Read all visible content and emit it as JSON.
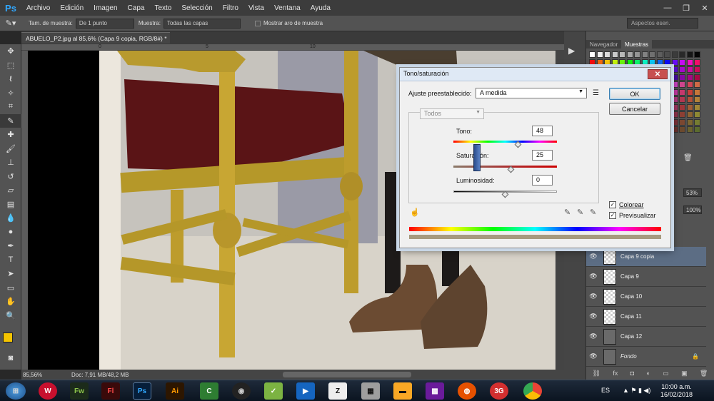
{
  "menubar": {
    "logo": "Ps",
    "items": [
      "Archivo",
      "Edición",
      "Imagen",
      "Capa",
      "Texto",
      "Selección",
      "Filtro",
      "Vista",
      "Ventana",
      "Ayuda"
    ],
    "window_controls": [
      "—",
      "❐",
      "✕"
    ]
  },
  "options": {
    "sample_size_label": "Tam. de muestra:",
    "sample_size_value": "De 1 punto",
    "sample_label": "Muestra:",
    "sample_value": "Todas las capas",
    "show_ring_label": "Mostrar aro de muestra",
    "workspace": "Aspectos esen."
  },
  "document": {
    "tab_title": "ABUELO_P2.jpg al 85,6% (Capa 9 copia, RGB/8#) *",
    "tab_close": "×",
    "zoom": "85,56%",
    "doc_info": "Doc: 7,91 MB/48,2 MB",
    "ruler_marks": [
      "0",
      "5",
      "10",
      "15",
      "20",
      "25"
    ]
  },
  "tools": [
    "move-icon",
    "marquee-icon",
    "lasso-icon",
    "quick-select-icon",
    "crop-icon",
    "eyedropper-icon",
    "healing-icon",
    "brush-icon",
    "stamp-icon",
    "history-brush-icon",
    "eraser-icon",
    "gradient-icon",
    "blur-icon",
    "dodge-icon",
    "pen-icon",
    "type-icon",
    "path-select-icon",
    "shape-icon",
    "hand-icon",
    "zoom-icon"
  ],
  "colors": {
    "foreground": "#f5c400",
    "background": "#ffffff"
  },
  "panel": {
    "tabs": [
      "Navegador",
      "Muestras"
    ],
    "opacity_value": "53%",
    "fill_value": "100%",
    "layers": [
      {
        "name": "Capa 9 copia",
        "active": true
      },
      {
        "name": "Capa 9",
        "active": false
      },
      {
        "name": "Capa 10",
        "active": false
      },
      {
        "name": "Capa 11",
        "active": false
      },
      {
        "name": "Capa 12",
        "active": false
      },
      {
        "name": "Fondo",
        "active": false,
        "italic": true
      }
    ]
  },
  "dialog": {
    "title": "Tono/saturación",
    "close": "✕",
    "preset_label": "Ajuste preestablecido:",
    "preset_value": "A medida",
    "channel_value": "Todos",
    "hue_label": "Tono:",
    "hue_value": "48",
    "saturation_label": "Saturación:",
    "saturation_value": "25",
    "lightness_label": "Luminosidad:",
    "lightness_value": "0",
    "hue_level": 0.63,
    "saturation_level": 0.56,
    "lightness_level": 0.5,
    "ok_label": "OK",
    "cancel_label": "Cancelar",
    "colorize_label": "Colorear",
    "preview_label": "Previsualizar"
  },
  "taskbar": {
    "language": "ES",
    "time": "10:00 a.m.",
    "date": "16/02/2018",
    "apps": [
      "Fw",
      "Fl",
      "Ps",
      "Ai"
    ]
  }
}
